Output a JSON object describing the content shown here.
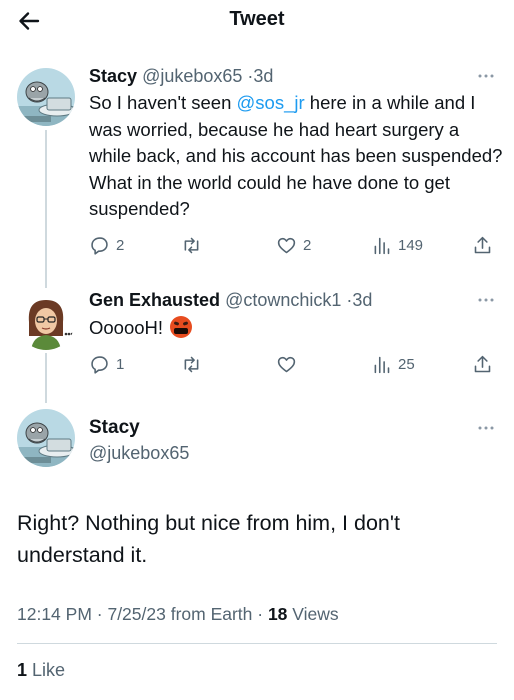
{
  "header": {
    "title": "Tweet"
  },
  "tweets": [
    {
      "name": "Stacy",
      "handle": "@jukebox65",
      "separator": "·",
      "time": "3d",
      "text_before": "So I haven't seen ",
      "mention": "@sos_jr",
      "text_after": " here in a while and I was worried, because he had heart surgery a while back, and his account has been suspended? What in the world could he have done to get suspended?",
      "replies": "2",
      "retweets": "",
      "likes": "2",
      "views": "149"
    },
    {
      "name": "Gen Exhausted",
      "handle": "@ctownchick1",
      "separator": "·",
      "time": "3d",
      "text": "OooooH!",
      "emoji": "angry-face-emoji",
      "replies": "1",
      "retweets": "",
      "likes": "",
      "views": "25"
    }
  ],
  "main_tweet": {
    "name": "Stacy",
    "handle": "@jukebox65",
    "text": "Right? Nothing but nice from him, I don't understand it.",
    "meta_prefix": "12:14 PM · 7/25/23 from Earth · ",
    "views_count": "18",
    "views_label": " Views",
    "likes_count": "1",
    "likes_label": " Like"
  },
  "colors": {
    "link": "#1d9bf0",
    "secondary": "#536471",
    "border": "#cfd9de"
  }
}
